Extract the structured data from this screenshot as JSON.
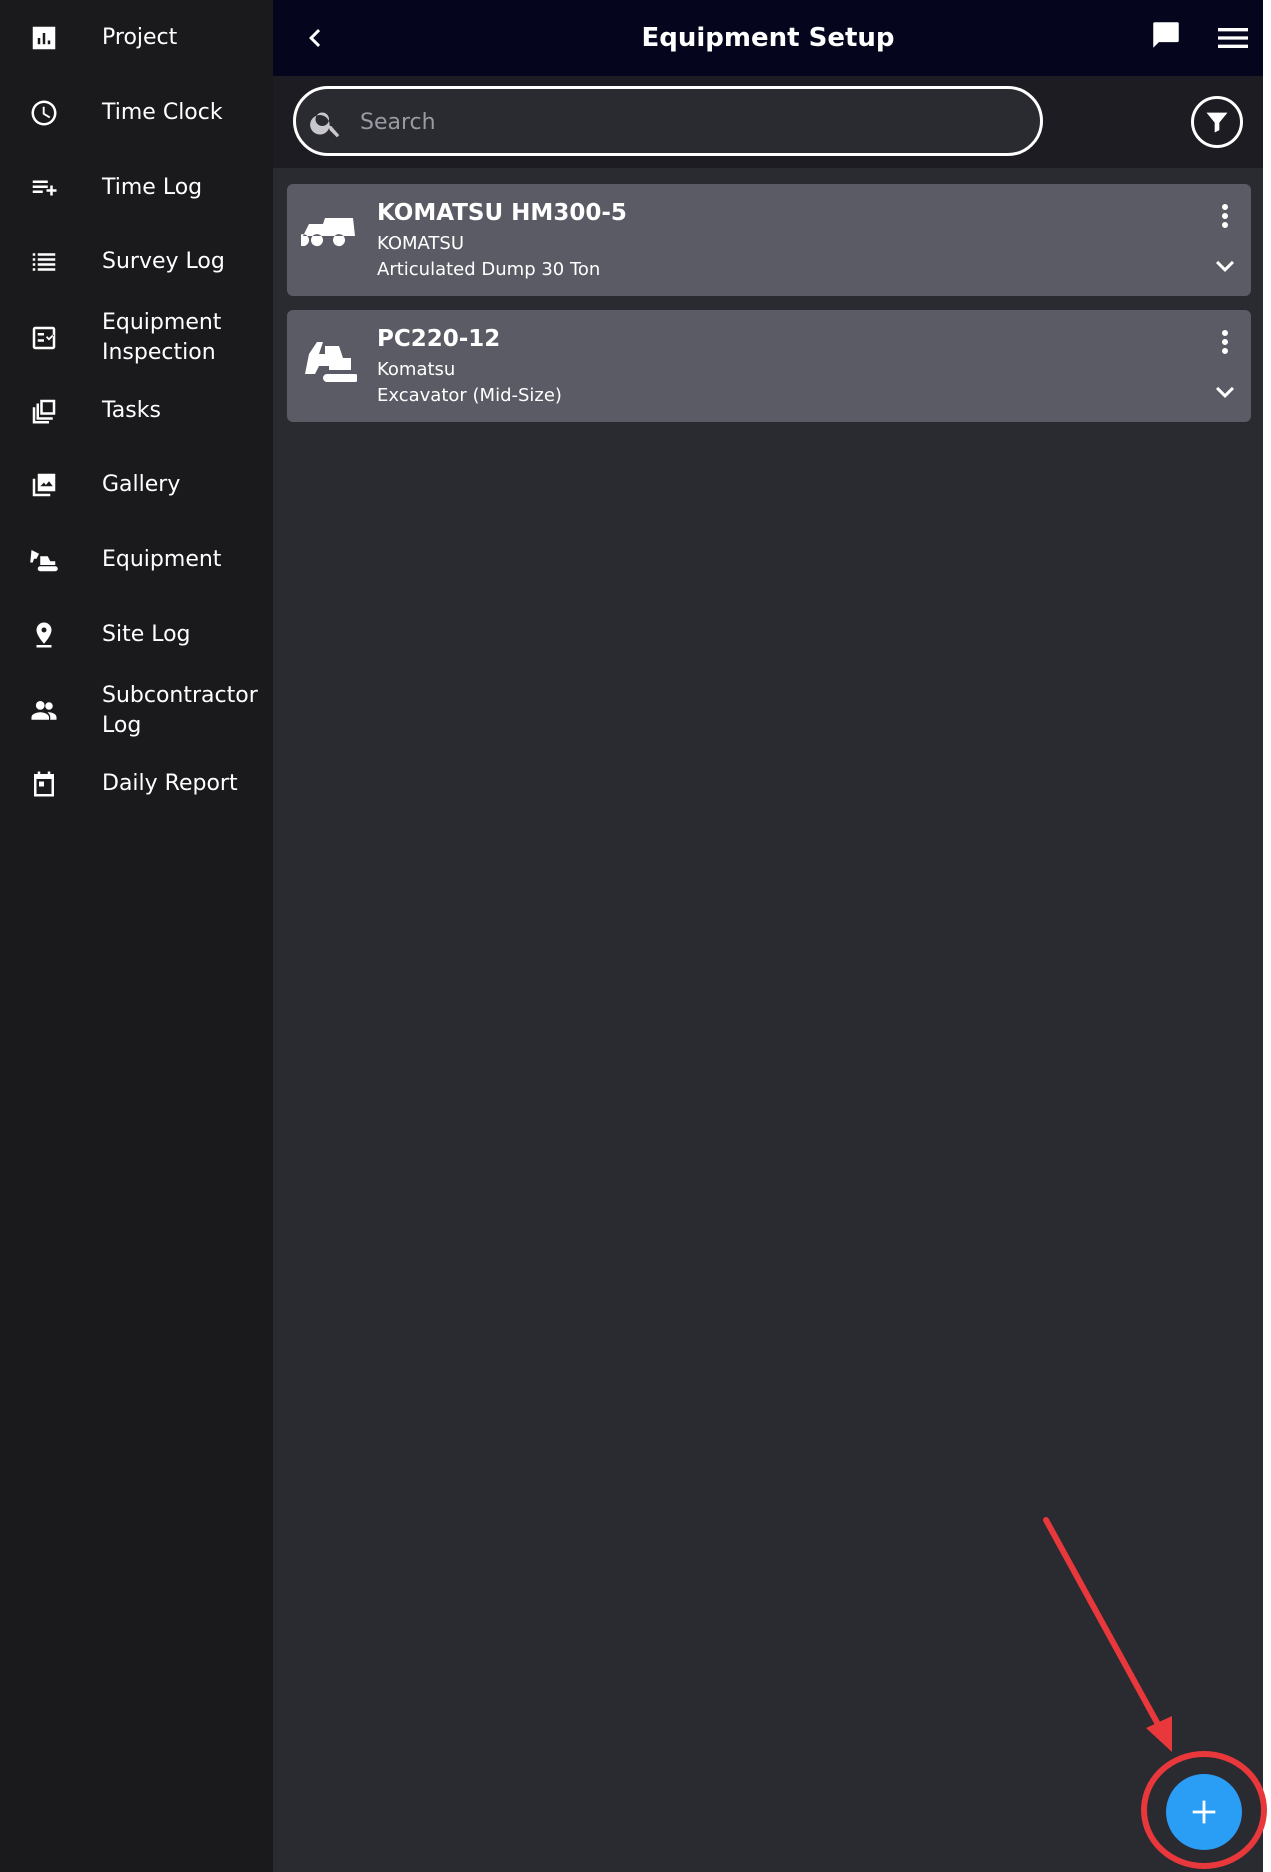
{
  "header": {
    "title": "Equipment Setup",
    "back_icon": "chevron-left-icon",
    "chat_icon": "chat-icon",
    "menu_icon": "hamburger-menu-icon"
  },
  "sidebar": {
    "items": [
      {
        "label": "Project",
        "icon": "bar-chart-icon"
      },
      {
        "label": "Time Clock",
        "icon": "clock-icon"
      },
      {
        "label": "Time Log",
        "icon": "playlist-add-icon"
      },
      {
        "label": "Survey Log",
        "icon": "list-icon"
      },
      {
        "label": "Equipment\nInspection",
        "icon": "checklist-icon"
      },
      {
        "label": "Tasks",
        "icon": "stacked-cards-icon"
      },
      {
        "label": "Gallery",
        "icon": "image-gallery-icon"
      },
      {
        "label": "Equipment",
        "icon": "excavator-icon"
      },
      {
        "label": "Site Log",
        "icon": "location-pin-icon"
      },
      {
        "label": "Subcontractor\nLog",
        "icon": "people-icon"
      },
      {
        "label": "Daily Report",
        "icon": "calendar-icon"
      }
    ]
  },
  "search": {
    "placeholder": "Search",
    "value": "",
    "icon": "search-icon",
    "filter_icon": "filter-icon"
  },
  "equipment": [
    {
      "name": "KOMATSU HM300-5",
      "make": "KOMATSU",
      "type": "Articulated Dump 30 Ton",
      "icon": "dump-truck-icon"
    },
    {
      "name": "PC220-12",
      "make": "Komatsu",
      "type": "Excavator (Mid-Size)",
      "icon": "excavator-icon"
    }
  ],
  "fab": {
    "icon": "plus-icon"
  },
  "colors": {
    "sidebar_bg": "#1a1a1c",
    "topbar_bg": "#05051e",
    "main_bg": "#2a2a31",
    "card_bg": "#5b5b66",
    "fab": "#2a9df4",
    "annotation": "#e8383b"
  }
}
